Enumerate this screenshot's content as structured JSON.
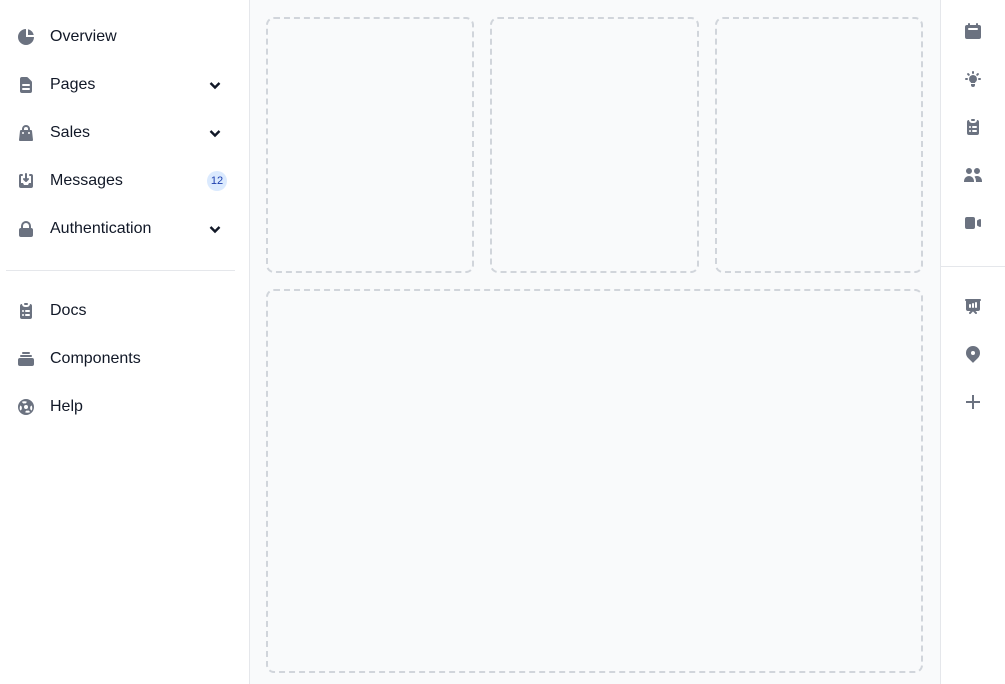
{
  "sidebar": {
    "items": [
      {
        "label": "Overview",
        "icon": "pie-chart-icon"
      },
      {
        "label": "Pages",
        "icon": "document-icon",
        "expandable": true
      },
      {
        "label": "Sales",
        "icon": "shopping-bag-icon",
        "expandable": true
      },
      {
        "label": "Messages",
        "icon": "inbox-icon",
        "badge": "12"
      },
      {
        "label": "Authentication",
        "icon": "lock-icon",
        "expandable": true
      }
    ],
    "secondary": [
      {
        "label": "Docs",
        "icon": "clipboard-list-icon"
      },
      {
        "label": "Components",
        "icon": "collection-icon"
      },
      {
        "label": "Help",
        "icon": "support-icon"
      }
    ]
  },
  "rightbar": {
    "top": [
      "calendar-icon",
      "lightbulb-icon",
      "clipboard-icon",
      "users-icon",
      "video-icon"
    ],
    "bottom": [
      "presentation-icon",
      "map-pin-icon",
      "plus-icon"
    ]
  },
  "colors": {
    "icon": "#6b7280",
    "badge_bg": "#dbeafe",
    "badge_text": "#1e40af",
    "placeholder_border": "#d1d5db",
    "main_bg": "#f9fafb"
  }
}
